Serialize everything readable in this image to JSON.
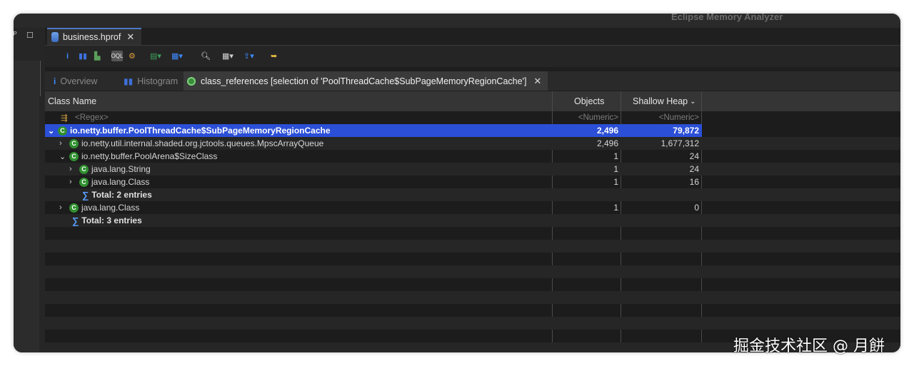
{
  "app": {
    "title": "Eclipse Memory Analyzer"
  },
  "editor_tab": {
    "label": "business.hprof"
  },
  "toolbar": {
    "icons": [
      "info-icon",
      "histogram-icon",
      "dominator-tree-icon",
      "oql-icon",
      "threads-icon",
      "reports-icon",
      "query-browser-icon",
      "find-object-icon",
      "calculator-icon",
      "group-icon",
      "export-icon",
      "leak-suspects-icon"
    ]
  },
  "view_tabs": [
    {
      "label": "Overview"
    },
    {
      "label": "Histogram"
    },
    {
      "label": "class_references [selection of 'PoolThreadCache$SubPageMemoryRegionCache']"
    }
  ],
  "table": {
    "columns": {
      "class_name": "Class Name",
      "objects": "Objects",
      "shallow_heap": "Shallow Heap"
    },
    "filter": {
      "class_name": "<Regex>",
      "objects": "<Numeric>",
      "shallow_heap": "<Numeric>"
    },
    "rows": [
      {
        "name": "io.netty.buffer.PoolThreadCache$SubPageMemoryRegionCache",
        "objects": "2,496",
        "heap": "79,872"
      },
      {
        "name": "io.netty.util.internal.shaded.org.jctools.queues.MpscArrayQueue",
        "objects": "2,496",
        "heap": "1,677,312"
      },
      {
        "name": "io.netty.buffer.PoolArena$SizeClass",
        "objects": "1",
        "heap": "24"
      },
      {
        "name": "java.lang.String",
        "objects": "1",
        "heap": "24"
      },
      {
        "name": "java.lang.Class",
        "objects": "1",
        "heap": "16"
      },
      {
        "name": "Total: 2 entries"
      },
      {
        "name": "java.lang.Class",
        "objects": "1",
        "heap": "0"
      },
      {
        "name": "Total: 3 entries"
      }
    ]
  },
  "watermark": "掘金技术社区 @ 月餅",
  "colors": {
    "selection": "#2b4fd6",
    "class_icon": "#2f8f2f",
    "tab_accent": "#4a78c8"
  }
}
